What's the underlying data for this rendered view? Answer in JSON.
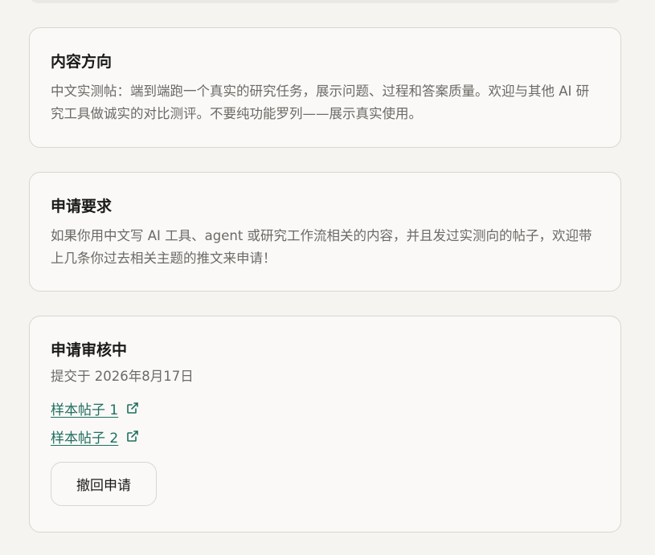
{
  "direction_card": {
    "title": "内容方向",
    "body": "中文实测帖：端到端跑一个真实的研究任务，展示问题、过程和答案质量。欢迎与其他 AI 研究工具做诚实的对比测评。不要纯功能罗列——展示真实使用。"
  },
  "requirements_card": {
    "title": "申请要求",
    "body": "如果你用中文写 AI 工具、agent 或研究工作流相关的内容，并且发过实测向的帖子，欢迎带上几条你过去相关主题的推文来申请！"
  },
  "status_card": {
    "title": "申请审核中",
    "submitted": "提交于 2026年8月17日",
    "links": [
      {
        "label": "样本帖子 1",
        "icon": "external-link-icon"
      },
      {
        "label": "样本帖子 2",
        "icon": "external-link-icon"
      }
    ],
    "withdraw_label": "撤回申请"
  },
  "colors": {
    "page_background": "#f5f4f1",
    "card_background": "#faf9f7",
    "border": "#d8d6d0",
    "link": "#1f6f60",
    "muted_text": "#6b6a66"
  }
}
